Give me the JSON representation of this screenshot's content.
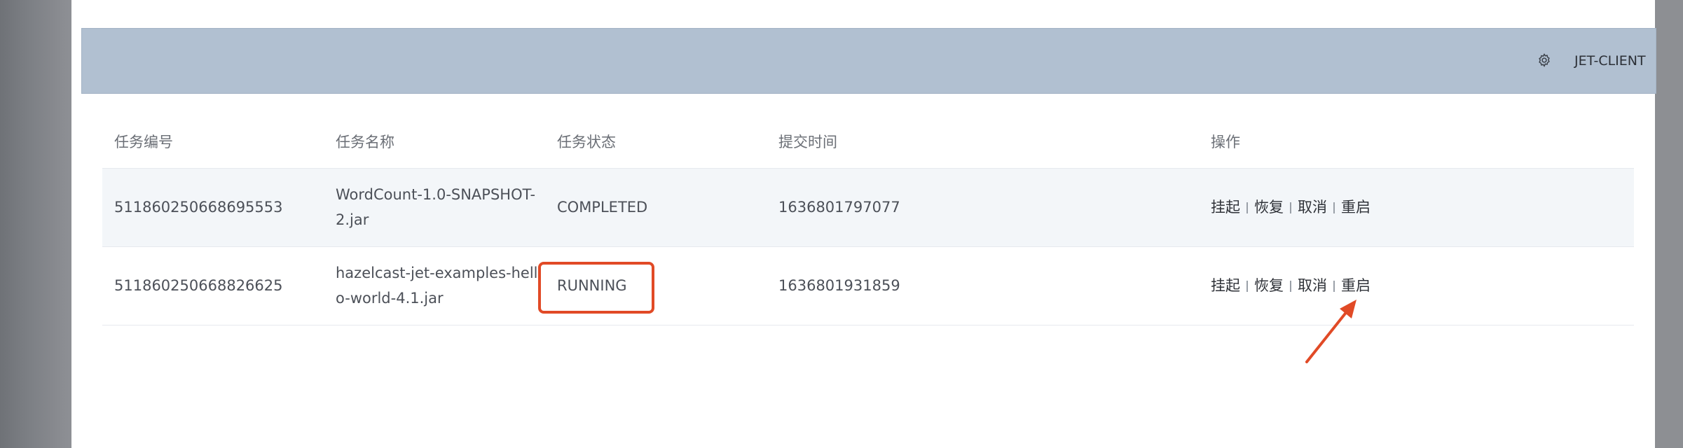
{
  "header": {
    "client_label": "JET-CLIENT",
    "icon": "gear-icon"
  },
  "table": {
    "columns": [
      "任务编号",
      "任务名称",
      "任务状态",
      "提交时间",
      "操作"
    ],
    "rows": [
      {
        "id": "511860250668695553",
        "name": "WordCount-1.0-SNAPSHOT-2.jar",
        "status": "COMPLETED",
        "submit_time": "1636801797077",
        "actions": [
          "挂起",
          "恢复",
          "取消",
          "重启"
        ]
      },
      {
        "id": "511860250668826625",
        "name": "hazelcast-jet-examples-hello-world-4.1.jar",
        "status": "RUNNING",
        "submit_time": "1636801931859",
        "actions": [
          "挂起",
          "恢复",
          "取消",
          "重启"
        ]
      }
    ]
  },
  "annotations": {
    "highlight_color": "#e14a26"
  }
}
